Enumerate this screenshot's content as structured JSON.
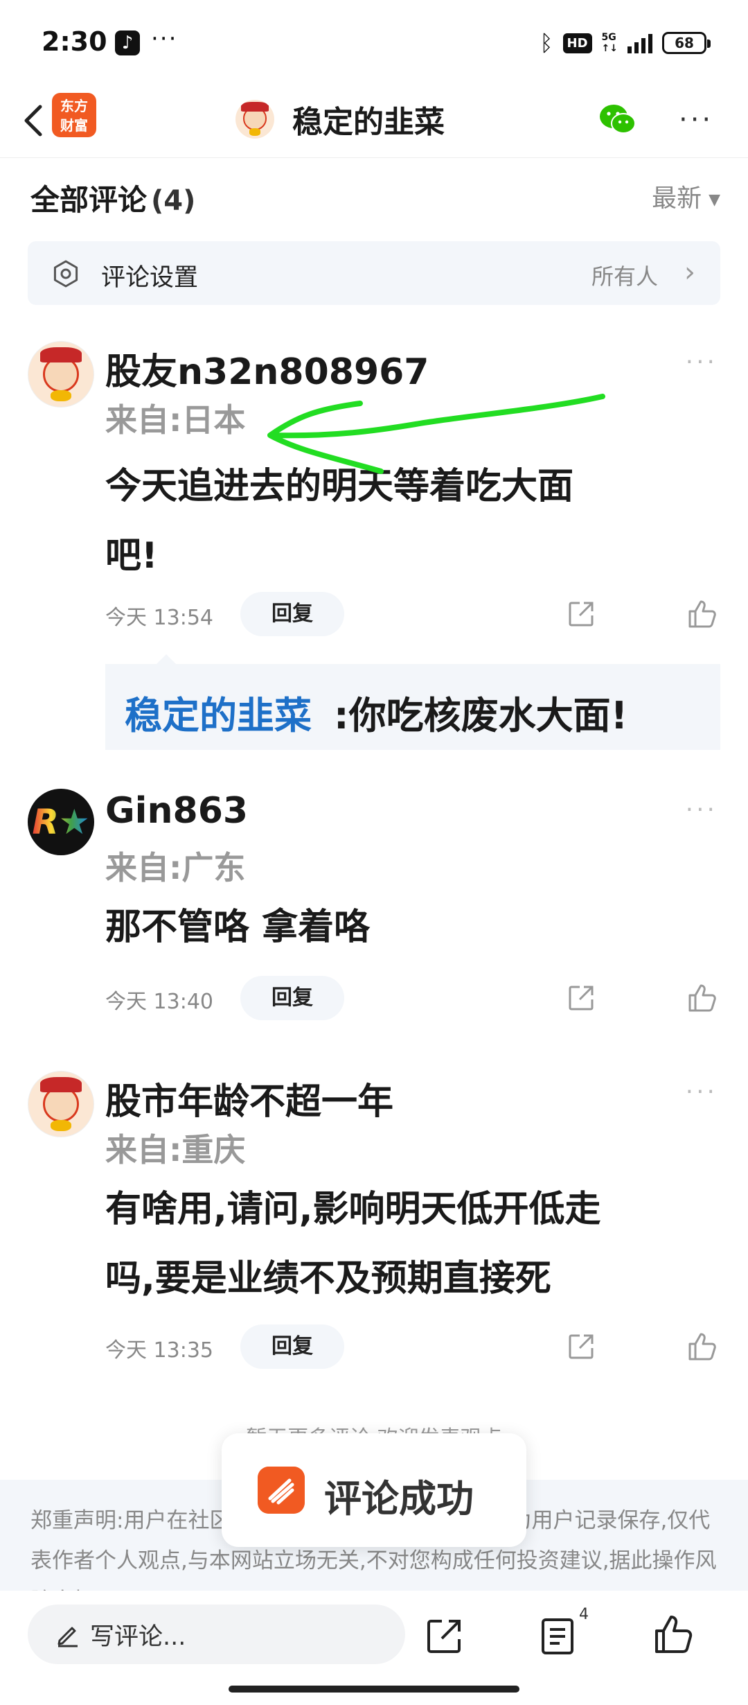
{
  "status_bar": {
    "time": "2:30",
    "hd": "HD",
    "network": "5G",
    "battery": "68"
  },
  "nav": {
    "logo_text_line1": "东方",
    "logo_text_line2": "财富",
    "title": "稳定的韭菜"
  },
  "list_header": {
    "title": "全部评论",
    "count": "(4)",
    "sort": "最新"
  },
  "settings": {
    "label": "评论设置",
    "value": "所有人"
  },
  "comments": [
    {
      "name": "股友n32n808967",
      "location": "来自:日本",
      "text_line1": "今天追进去的明天等着吃大面",
      "text_line2": "吧!",
      "time": "今天 13:54",
      "reply": "回复",
      "sub_reply": {
        "author": "稳定的韭菜",
        "text": ":你吃核废水大面!"
      }
    },
    {
      "name": "Gin863",
      "location": "来自:广东",
      "text_line1": "那不管咯 拿着咯",
      "time": "今天 13:40",
      "reply": "回复"
    },
    {
      "name": "股市年龄不超一年",
      "location": "来自:重庆",
      "text_line1": "有啥用,请问,影响明天低开低走",
      "text_line2": "吗,要是业绩不及预期直接死",
      "time": "今天 13:35",
      "reply": "回复"
    }
  ],
  "no_more": "暂无更多评论,欢迎发表观点",
  "disclaimer": "郑重声明:用户在社区发表的所有资料、言论等仅作为用户记录保存,仅代表作者个人观点,与本网站立场无关,不对您构成任何投资建议,据此操作风险自担。",
  "toast": "评论成功",
  "bottom_bar": {
    "input_placeholder": "写评论...",
    "comment_count": "4"
  },
  "colors": {
    "brand_orange": "#f15a22",
    "link_blue": "#1e70c8",
    "annotation_green": "#22dd22"
  }
}
